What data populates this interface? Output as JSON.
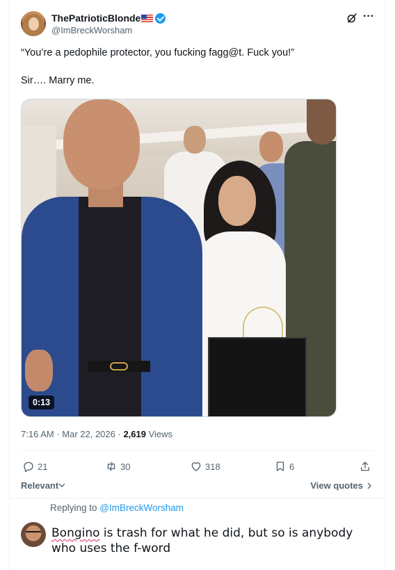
{
  "tweet": {
    "author": {
      "display_name": "ThePatrioticBlonde",
      "flag_icon": "us-flag-icon",
      "verified_icon": "verified-badge-icon",
      "handle": "@ImBreckWorsham"
    },
    "header_icons": [
      "grok-icon",
      "more-icon"
    ],
    "text_line1": "“You’re a pedophile protector, you fucking fagg@t. Fuck you!”",
    "text_line2": "Sir…. Marry me.",
    "media": {
      "type": "video",
      "duration": "0:13"
    },
    "meta": {
      "time": "7:16 AM",
      "separator1": " · ",
      "date": "Mar 22, 2026",
      "separator2": " · ",
      "views_count": "2,619",
      "views_label": " Views"
    },
    "actions": {
      "replies": "21",
      "reposts": "30",
      "likes": "318",
      "bookmarks": "6"
    },
    "sort_label": "Relevant",
    "view_quotes_label": "View quotes"
  },
  "reply": {
    "replying_to_prefix": "Replying to ",
    "replying_to_handle": "@ImBreckWorsham",
    "draft_word_misspelled": "Bongino",
    "draft_rest": " is trash for what he did, but so is anybody who uses the f-word"
  },
  "colors": {
    "accent": "#1d9bf0",
    "text_primary": "#0f1419",
    "text_secondary": "#536471",
    "divider": "#eff3f4"
  }
}
